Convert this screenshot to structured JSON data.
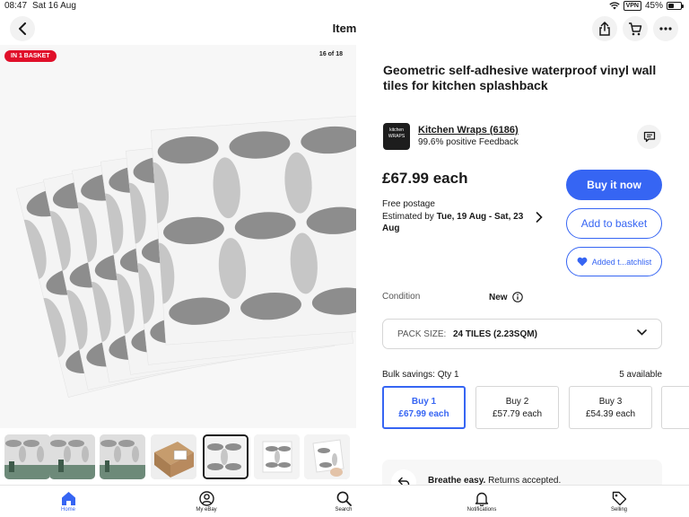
{
  "status_bar": {
    "time": "08:47",
    "date": "Sat 16 Aug",
    "vpn": "VPN",
    "battery": "45%",
    "battery_level": 0.45
  },
  "header": {
    "title": "Item",
    "icons": [
      "back-arrow-icon",
      "share-icon",
      "cart-icon",
      "more-icon"
    ]
  },
  "gallery": {
    "badge": "IN 1 BASKET",
    "counter": "16 of 18",
    "thumbnails": [
      {
        "kind": "tiles-kitchen",
        "selected": false
      },
      {
        "kind": "tiles-kitchen",
        "selected": false
      },
      {
        "kind": "tiles-kitchen",
        "selected": false
      },
      {
        "kind": "box",
        "selected": false
      },
      {
        "kind": "tiles-fan",
        "selected": true
      },
      {
        "kind": "tiles-single",
        "selected": false
      },
      {
        "kind": "tiles-hand",
        "selected": false
      }
    ]
  },
  "item": {
    "title": "Geometric self-adhesive waterproof vinyl wall tiles for kitchen splashback",
    "seller": {
      "logo_text": "kitchen WRAPS",
      "name": "Kitchen Wraps",
      "rating_count": "(6186)",
      "feedback": "99.6% positive Feedback"
    },
    "price": "£67.99 each",
    "postage": "Free postage",
    "delivery_prefix": "Estimated by ",
    "delivery_dates": "Tue, 19 Aug - Sat, 23 Aug",
    "buttons": {
      "buy_now": "Buy it now",
      "add_to_basket": "Add to basket",
      "watchlist": "Added t...atchlist"
    },
    "condition_label": "Condition",
    "condition_value": "New",
    "pack_size": {
      "label": "PACK SIZE:",
      "value": "24 TILES (2.23SQM)"
    },
    "bulk": {
      "label": "Bulk savings: Qty 1",
      "available": "5 available",
      "options": [
        {
          "qty": "Buy 1",
          "price": "£67.99 each",
          "selected": true
        },
        {
          "qty": "Buy 2",
          "price": "£57.79 each",
          "selected": false
        },
        {
          "qty": "Buy 3",
          "price": "£54.39 each",
          "selected": false
        },
        {
          "qty": "",
          "price": "",
          "selected": false
        }
      ]
    },
    "returns": {
      "bold": "Breathe easy.",
      "rest": " Returns accepted."
    }
  },
  "tabbar": {
    "tabs": [
      {
        "label": "Home",
        "icon": "home-icon",
        "active": true
      },
      {
        "label": "My eBay",
        "icon": "profile-icon",
        "active": false
      },
      {
        "label": "Search",
        "icon": "search-icon",
        "active": false
      },
      {
        "label": "Notifications",
        "icon": "bell-icon",
        "active": false
      },
      {
        "label": "Selling",
        "icon": "tag-icon",
        "active": false
      }
    ]
  },
  "colors": {
    "accent": "#3665f3",
    "badge": "#e0102a",
    "text": "#191919"
  }
}
